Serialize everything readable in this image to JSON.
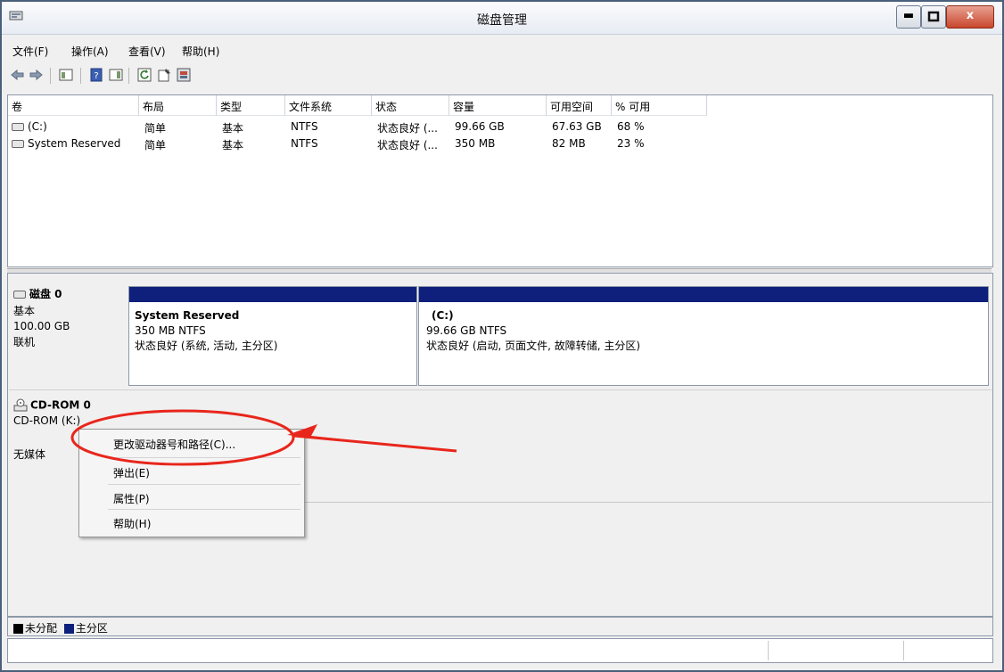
{
  "window": {
    "title": "磁盘管理"
  },
  "menu": [
    "文件(F)",
    "操作(A)",
    "查看(V)",
    "帮助(H)"
  ],
  "columns": [
    "卷",
    "布局",
    "类型",
    "文件系统",
    "状态",
    "容量",
    "可用空间",
    "% 可用"
  ],
  "volumes": [
    [
      "(C:)",
      "简单",
      "基本",
      "NTFS",
      "状态良好 (...",
      "99.66 GB",
      "67.63 GB",
      "68 %"
    ],
    [
      "System Reserved",
      "简单",
      "基本",
      "NTFS",
      "状态良好 (...",
      "350 MB",
      "82 MB",
      "23 %"
    ]
  ],
  "disk0": {
    "name": "磁盘 0",
    "type": "基本",
    "size": "100.00 GB",
    "status": "联机",
    "partitions": [
      {
        "name": "System Reserved",
        "size": "350 MB NTFS",
        "status": "状态良好 (系统, 活动, 主分区)"
      },
      {
        "name": "(C:)",
        "size": "99.66 GB NTFS",
        "status": "状态良好 (启动, 页面文件, 故障转储, 主分区)"
      }
    ]
  },
  "cdrom": {
    "name": "CD-ROM 0",
    "drive": "CD-ROM (K:)",
    "media": "无媒体"
  },
  "context_menu": [
    "更改驱动器号和路径(C)...",
    "弹出(E)",
    "属性(P)",
    "帮助(H)"
  ],
  "legend": {
    "unallocated": "未分配",
    "primary": "主分区",
    "unallocated_color": "#000000",
    "primary_color": "#0e1f7c"
  },
  "annotation_color": "#e8261c"
}
